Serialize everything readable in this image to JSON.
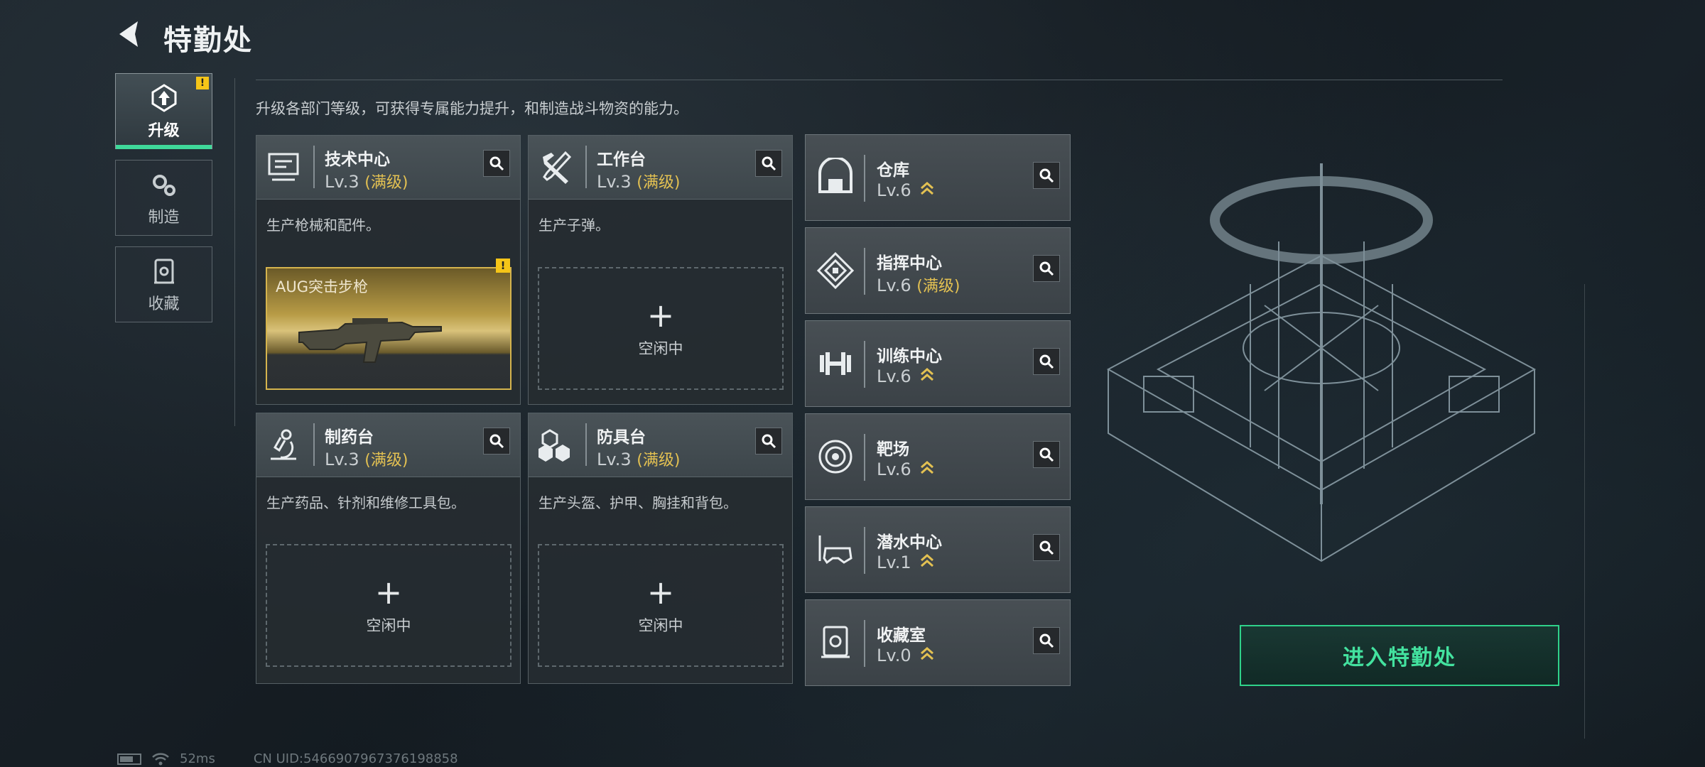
{
  "header": {
    "title": "特勤处"
  },
  "tabs": [
    {
      "label": "升级",
      "active": true,
      "alert": "!"
    },
    {
      "label": "制造",
      "active": false
    },
    {
      "label": "收藏",
      "active": false
    }
  ],
  "description": "升级各部门等级，可获得专属能力提升，和制造战斗物资的能力。",
  "cards": [
    {
      "name": "技术中心",
      "level": "Lv.3",
      "status": "(满级)",
      "desc": "生产枪械和配件。",
      "slot": {
        "filled": true,
        "item": "AUG突击步枪",
        "alert": "!"
      }
    },
    {
      "name": "工作台",
      "level": "Lv.3",
      "status": "(满级)",
      "desc": "生产子弹。",
      "slot": {
        "filled": false,
        "plus": "+",
        "idle": "空闲中"
      }
    },
    {
      "name": "制药台",
      "level": "Lv.3",
      "status": "(满级)",
      "desc": "生产药品、针剂和维修工具包。",
      "slot": {
        "filled": false,
        "plus": "+",
        "idle": "空闲中"
      }
    },
    {
      "name": "防具台",
      "level": "Lv.3",
      "status": "(满级)",
      "desc": "生产头盔、护甲、胸挂和背包。",
      "slot": {
        "filled": false,
        "plus": "+",
        "idle": "空闲中"
      }
    }
  ],
  "rows": [
    {
      "name": "仓库",
      "level": "Lv.6",
      "status": "",
      "upgrade": true
    },
    {
      "name": "指挥中心",
      "level": "Lv.6",
      "status": "(满级)",
      "upgrade": false
    },
    {
      "name": "训练中心",
      "level": "Lv.6",
      "status": "",
      "upgrade": true
    },
    {
      "name": "靶场",
      "level": "Lv.6",
      "status": "",
      "upgrade": true
    },
    {
      "name": "潜水中心",
      "level": "Lv.1",
      "status": "",
      "upgrade": true
    },
    {
      "name": "收藏室",
      "level": "Lv.0",
      "status": "",
      "upgrade": true
    }
  ],
  "enter_button": "进入特勤处",
  "footer": {
    "ping": "52ms",
    "uid": "CN UID:5466907967376198858"
  },
  "colors": {
    "accent_green": "#3fd99a",
    "max_gold": "#e3c152",
    "alert_yellow": "#f5c518"
  }
}
